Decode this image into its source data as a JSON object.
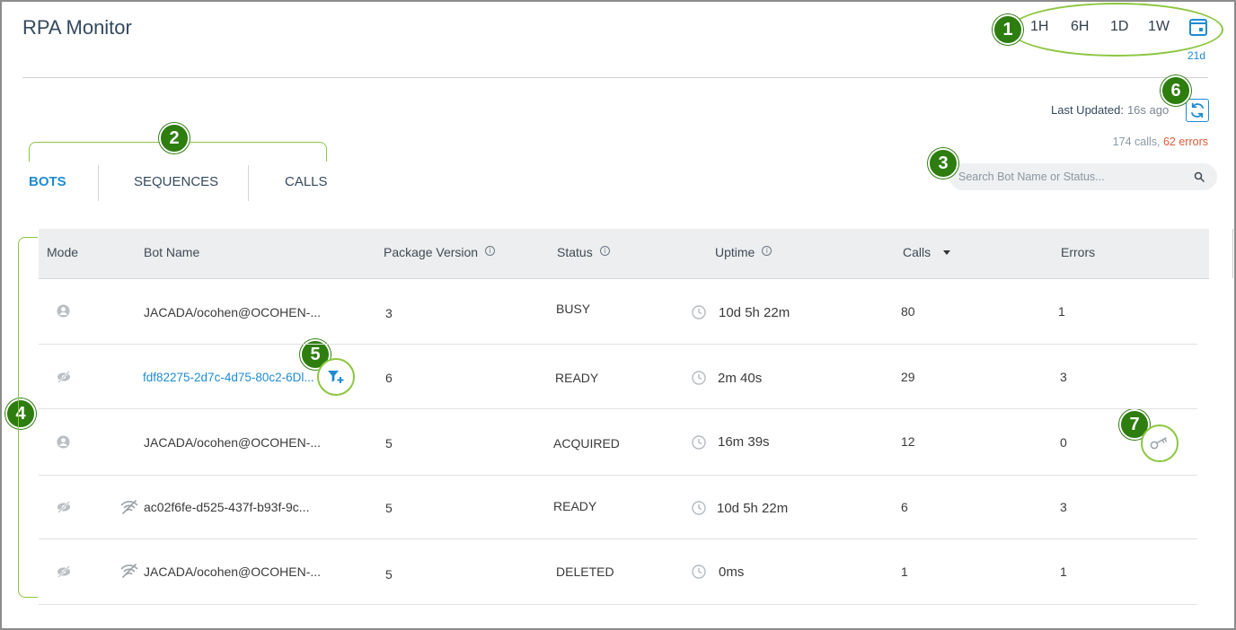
{
  "header": {
    "title": "RPA Monitor",
    "ranges": [
      "1H",
      "6H",
      "1D",
      "1W"
    ],
    "custom_range": "21d"
  },
  "status": {
    "last_updated_label": "Last Updated:",
    "last_updated_value": "16s ago",
    "calls": "174 calls,",
    "errors": "62 errors"
  },
  "tabs": [
    "BOTS",
    "SEQUENCES",
    "CALLS"
  ],
  "search": {
    "placeholder": "Search Bot Name or Status..."
  },
  "table": {
    "columns": [
      "Mode",
      "Bot Name",
      "Package Version",
      "Status",
      "Uptime",
      "Calls",
      "Errors"
    ],
    "rows": [
      {
        "mode": "user",
        "bot_name": "JACADA/ocohen@OCOHEN-...",
        "package_version": "3",
        "status": "BUSY",
        "uptime": "10d 5h 22m",
        "calls": "80",
        "errors": "1"
      },
      {
        "mode": "unattended",
        "bot_name": "fdf82275-2d7c-4d75-80c2-6Dl...",
        "package_version": "6",
        "status": "READY",
        "uptime": "2m 40s",
        "calls": "29",
        "errors": "3"
      },
      {
        "mode": "user",
        "bot_name": "JACADA/ocohen@OCOHEN-...",
        "package_version": "5",
        "status": "ACQUIRED",
        "uptime": "16m 39s",
        "calls": "12",
        "errors": "0"
      },
      {
        "mode": "unattended",
        "bot_name": "ac02f6fe-d525-437f-b93f-9c...",
        "package_version": "5",
        "status": "READY",
        "uptime": "10d 5h 22m",
        "calls": "6",
        "errors": "3"
      },
      {
        "mode": "unattended",
        "bot_name": "JACADA/ocohen@OCOHEN-...",
        "package_version": "5",
        "status": "DELETED",
        "uptime": "0ms",
        "calls": "1",
        "errors": "1"
      }
    ]
  },
  "callouts": [
    "1",
    "2",
    "3",
    "4",
    "5",
    "6",
    "7"
  ],
  "icons": {
    "calendar": "calendar-icon",
    "refresh": "refresh-icon",
    "search": "search-icon",
    "info": "info-icon",
    "user_mode": "user-circle-icon",
    "unattended_mode": "eye-off-icon",
    "disconnected": "wifi-off-icon",
    "clock": "clock-icon",
    "filter_add": "filter-add-icon",
    "key": "key-icon"
  },
  "colors": {
    "accent": "#1e8bd2",
    "callout": "#2e7d0f",
    "highlight": "#8cc63f",
    "error": "#e05a3a"
  }
}
